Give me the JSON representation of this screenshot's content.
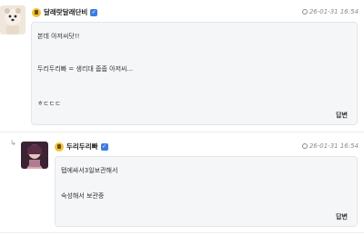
{
  "comments": [
    {
      "author": "달래랏달래단비",
      "date": "26-01-31 16:54",
      "lines": [
        "본데 아저씨닷!!",
        "두리두리빠 = 생리대 줍줍 아저씨...",
        "ㅎㄷㄷㄷ"
      ],
      "reply_label": "답변"
    },
    {
      "author": "두리두리빠",
      "date": "26-01-31 16:54",
      "lines": [
        "탭에싸서3일보관해서",
        "숙성해서 보관중"
      ],
      "reply_label": "답변"
    }
  ],
  "icons": {
    "level": "level-badge-icon",
    "verified": "verified-check-icon",
    "clock": "clock-icon",
    "reply_arrow": "reply-arrow-icon"
  },
  "colors": {
    "verified": "#3b7de0",
    "level": "#f2c233",
    "bubble_bg": "#f5f6f8"
  }
}
